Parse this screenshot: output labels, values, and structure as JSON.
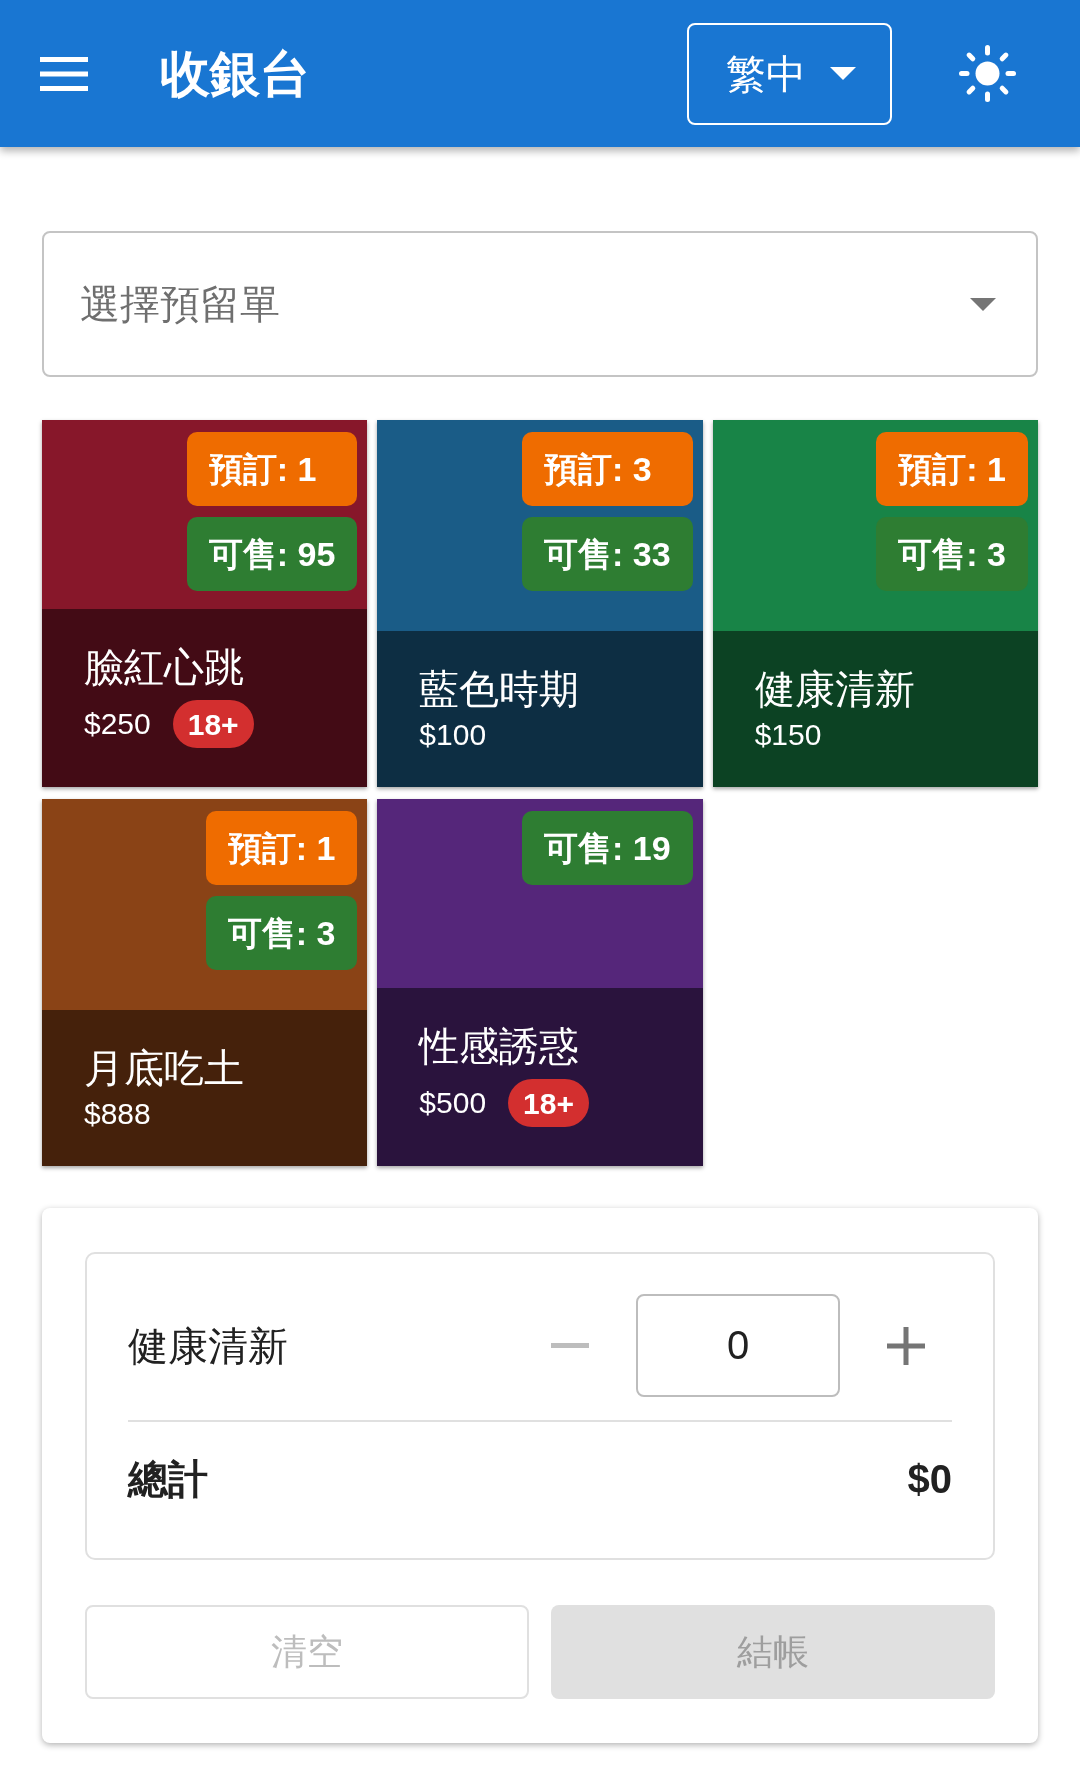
{
  "app_bar": {
    "title": "收銀台",
    "language": "繁中"
  },
  "reservation_select": {
    "placeholder": "選擇預留單"
  },
  "products": [
    {
      "name": "臉紅心跳",
      "price": "$250",
      "color": "#87172a",
      "reserved": "預訂: 1",
      "available": "可售: 95",
      "age_badge": "18+"
    },
    {
      "name": "藍色時期",
      "price": "$100",
      "color": "#1a5c87",
      "reserved": "預訂: 3",
      "available": "可售: 33"
    },
    {
      "name": "健康清新",
      "price": "$150",
      "color": "#188447",
      "reserved": "預訂: 1",
      "available": "可售: 3"
    },
    {
      "name": "月底吃土",
      "price": "$888",
      "color": "#8a4316",
      "reserved": "預訂: 1",
      "available": "可售: 3"
    },
    {
      "name": "性感誘惑",
      "price": "$500",
      "color": "#55267a",
      "available": "可售: 19",
      "age_badge": "18+"
    }
  ],
  "cart": {
    "items": [
      {
        "name": "健康清新",
        "quantity": "0",
        "decrease_disabled": true
      }
    ],
    "total_label": "總計",
    "total": "$0"
  },
  "buttons": [
    {
      "label": "清空",
      "kind": "clear",
      "disabled": true
    },
    {
      "label": "結帳",
      "kind": "checkout",
      "disabled": true
    }
  ]
}
